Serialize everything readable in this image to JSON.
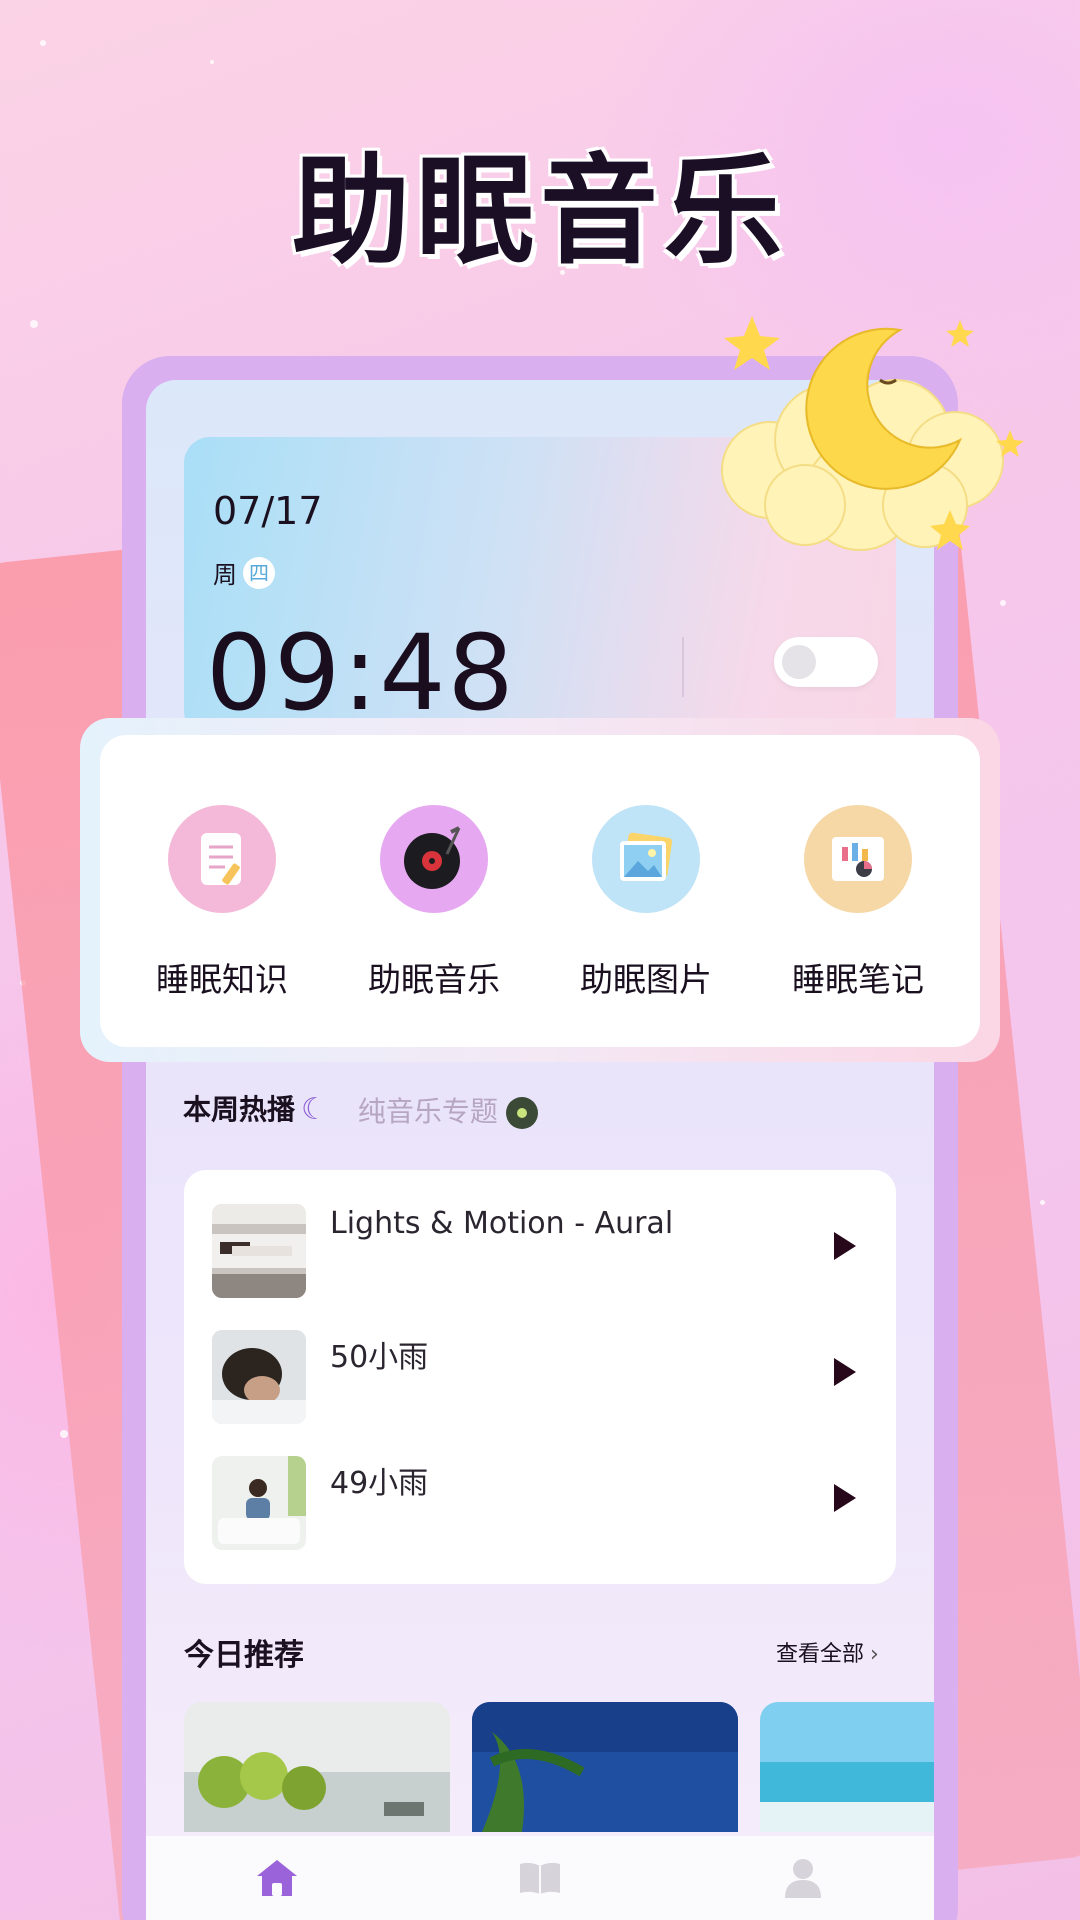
{
  "headline": "助眠音乐",
  "clock": {
    "date": "07/17",
    "weekday_prefix": "周",
    "weekday": "四",
    "time": "09:48"
  },
  "menu": {
    "items": [
      {
        "label": "睡眠知识",
        "icon": "notepad-icon",
        "color": "#f4b9d8"
      },
      {
        "label": "助眠音乐",
        "icon": "vinyl-record-icon",
        "color": "#e6a9f1"
      },
      {
        "label": "助眠图片",
        "icon": "picture-icon",
        "color": "#bfe3f7"
      },
      {
        "label": "睡眠笔记",
        "icon": "chart-notebook-icon",
        "color": "#f6d7a6"
      }
    ]
  },
  "tabs": {
    "active": "本周热播",
    "inactive": "纯音乐专题"
  },
  "songs": [
    {
      "title": "Lights & Motion - Aural"
    },
    {
      "title": "50小雨"
    },
    {
      "title": "49小雨"
    }
  ],
  "recommend": {
    "title": "今日推荐",
    "see_all": "查看全部"
  },
  "nav": {
    "items": [
      {
        "icon": "home-icon",
        "active": true
      },
      {
        "icon": "book-icon",
        "active": false
      },
      {
        "icon": "user-icon",
        "active": false
      }
    ]
  },
  "colors": {
    "accent": "#9b63d9",
    "phone_frame": "#d9aff0",
    "play": "#26081a"
  }
}
